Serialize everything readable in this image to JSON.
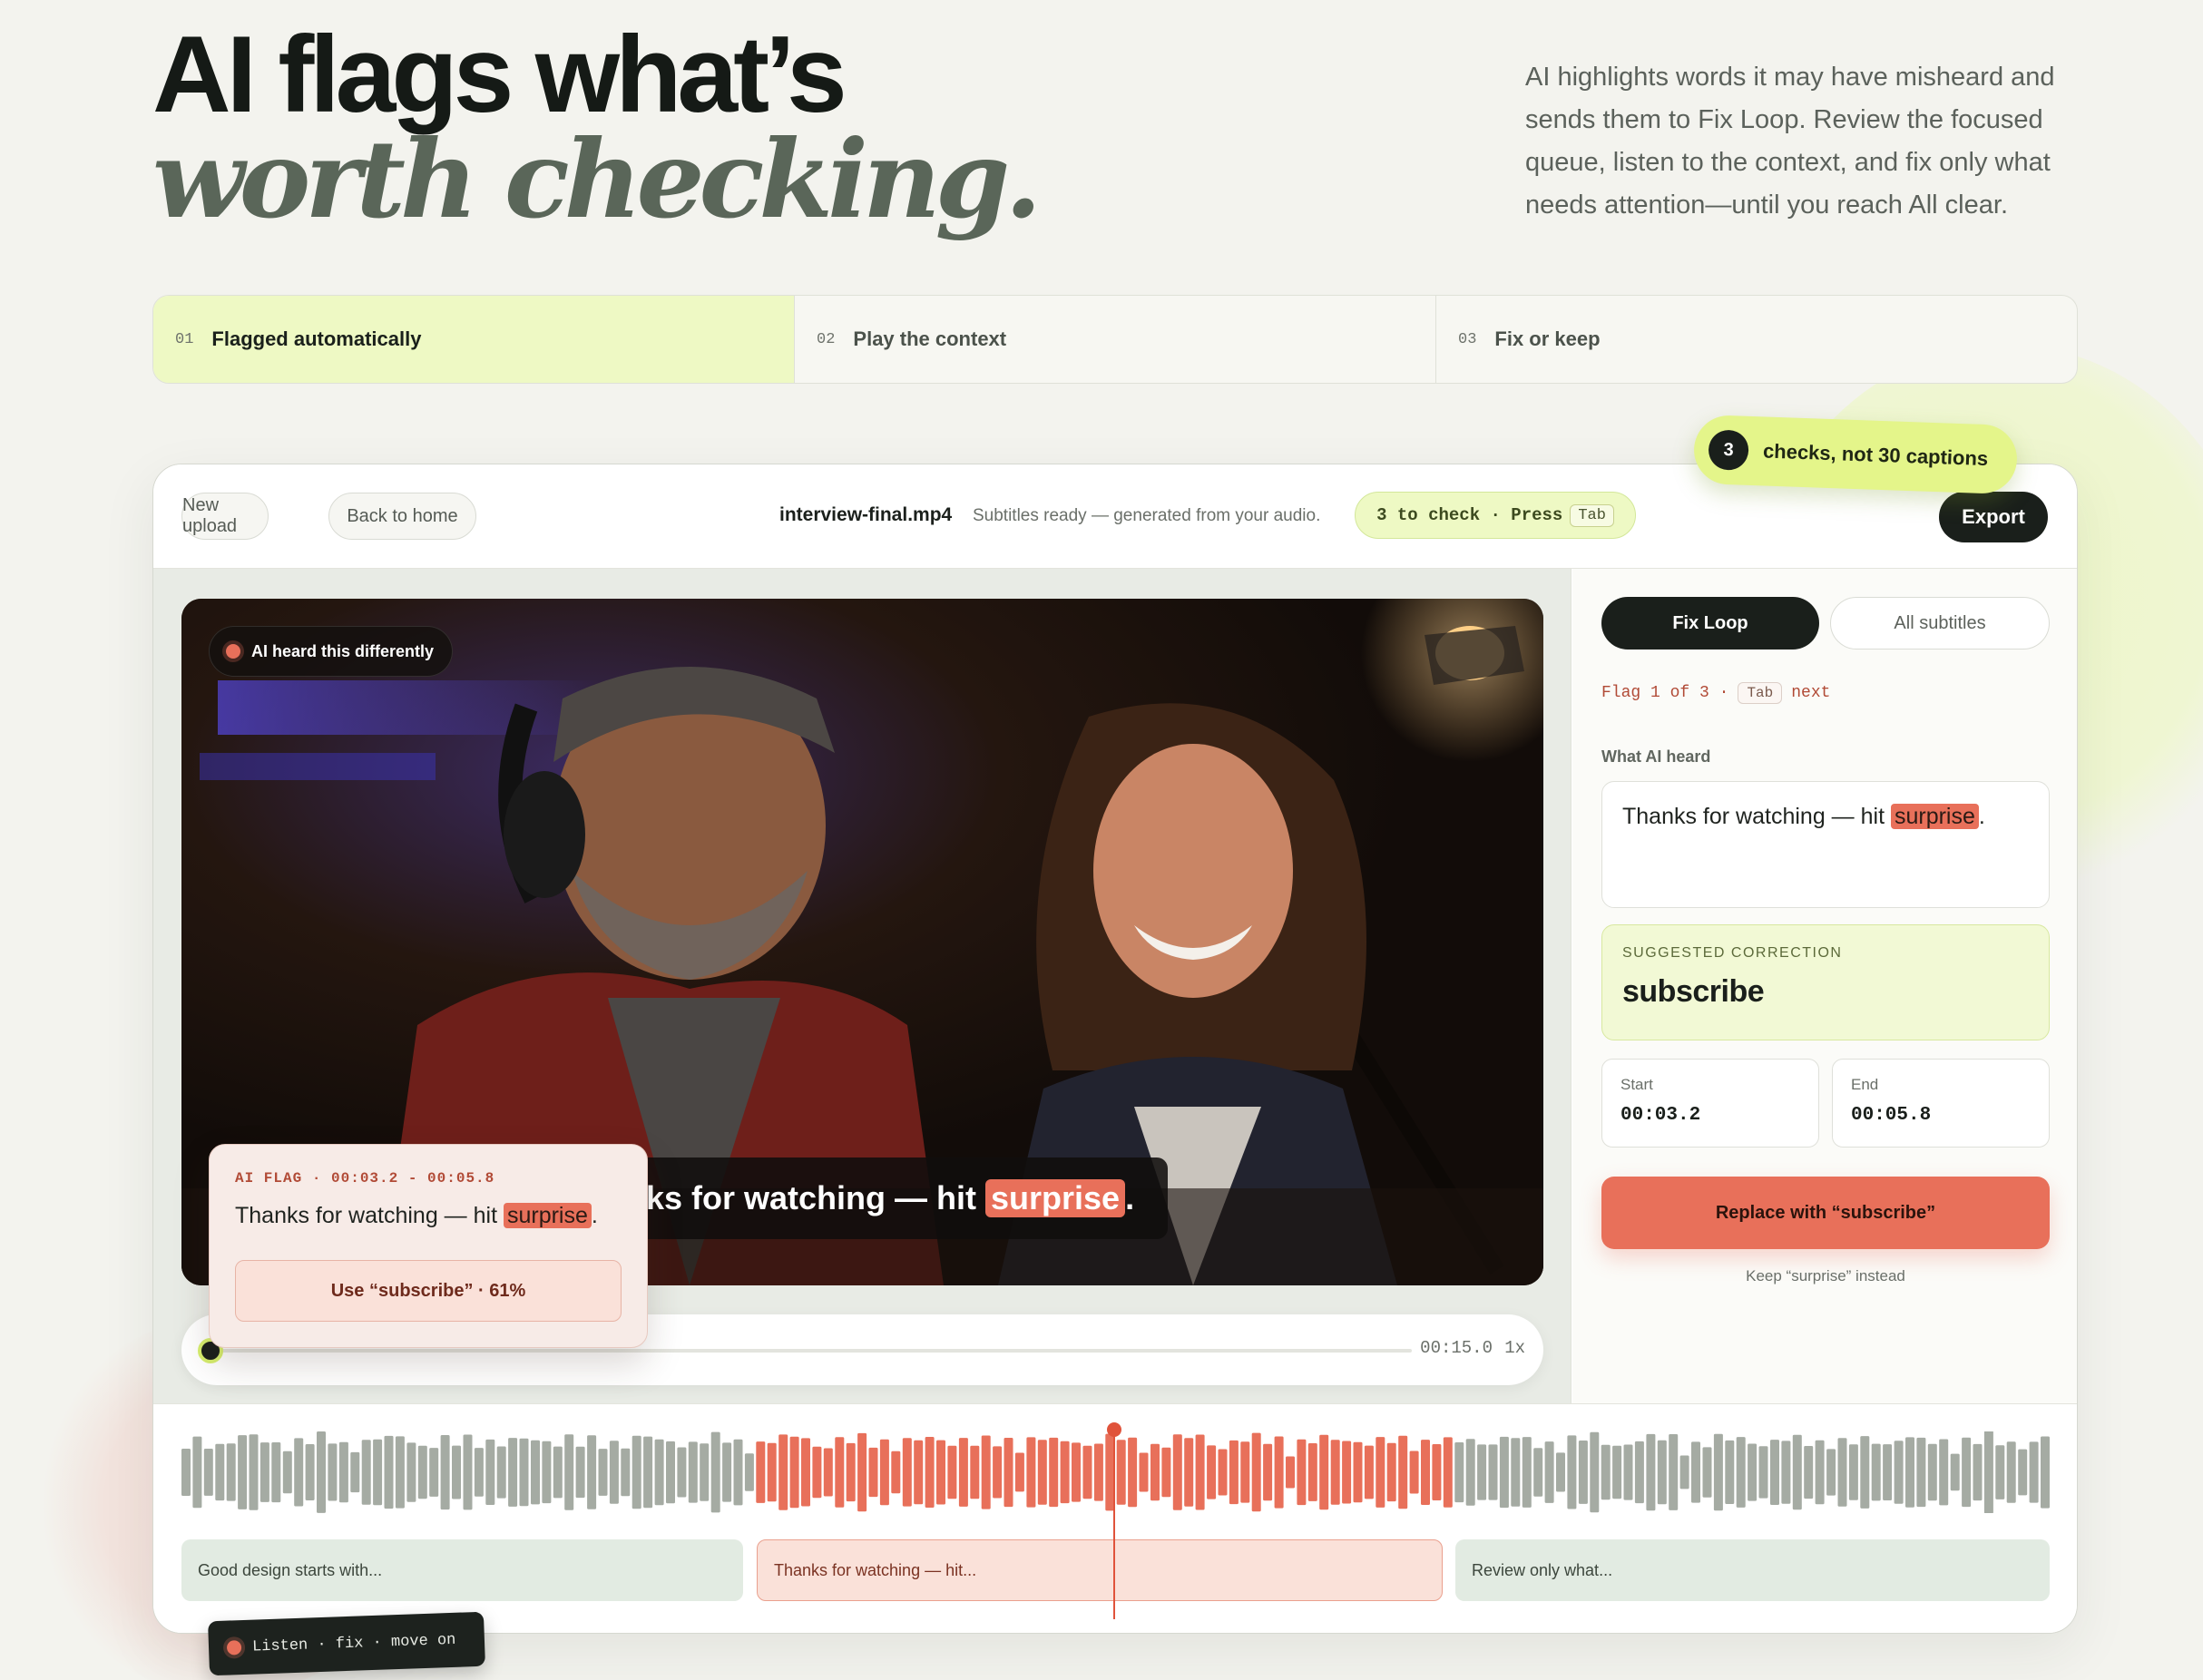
{
  "hero": {
    "title_line1": "AI flags what’s",
    "title_line2": "worth checking.",
    "description": "AI highlights words it may have misheard and sends them to Fix Loop. Review the focused queue, listen to the context, and fix only what needs attention—until you reach All clear."
  },
  "steps": [
    {
      "num": "01",
      "label": "Flagged automatically",
      "active": true
    },
    {
      "num": "02",
      "label": "Play the context",
      "active": false
    },
    {
      "num": "03",
      "label": "Fix or keep",
      "active": false
    }
  ],
  "topbar": {
    "new_upload": "New upload",
    "back_home": "Back to home",
    "filename": "interview-final.mp4",
    "status": "Subtitles ready — generated from your audio.",
    "check_text": "3 to check · Press",
    "check_key": "Tab",
    "export": "Export"
  },
  "video": {
    "badge": "AI heard this differently",
    "caption_prefix": "nks for watching — hit",
    "caption_word": "surprise",
    "caption_suffix": ".",
    "time": "00:15.0",
    "speed": "1x"
  },
  "flag_popover": {
    "meta": "AI FLAG · 00:03.2 - 00:05.8",
    "text_prefix": "Thanks for watching — hit",
    "text_word": "surprise",
    "text_suffix": ".",
    "use_button": "Use “subscribe” · 61%"
  },
  "panel": {
    "tab_fix": "Fix Loop",
    "tab_all": "All subtitles",
    "flag_count": "Flag 1 of 3 ·",
    "flag_key": "Tab",
    "flag_next": "next",
    "heard_label": "What AI heard",
    "heard_prefix": "Thanks for watching — hit",
    "heard_word": "surprise",
    "heard_suffix": ".",
    "suggest_label": "SUGGESTED CORRECTION",
    "suggest_value": "subscribe",
    "start_label": "Start",
    "start_value": "00:03.2",
    "end_label": "End",
    "end_value": "00:05.8",
    "replace_button": "Replace with “subscribe”",
    "keep_link": "Keep “surprise” instead"
  },
  "timeline": {
    "clips": [
      {
        "text": "Good design starts with...",
        "state": "ok"
      },
      {
        "text": "Thanks for watching — hit...",
        "state": "flagged"
      },
      {
        "text": "Review only what...",
        "state": "ok"
      }
    ]
  },
  "badges": {
    "checks_num": "3",
    "checks_text": "checks, not 30 captions",
    "listen": "Listen · fix · move on"
  },
  "colors": {
    "accent_lime": "#e4f58a",
    "flag_red": "#e8705a",
    "dark": "#1a1f1b"
  }
}
